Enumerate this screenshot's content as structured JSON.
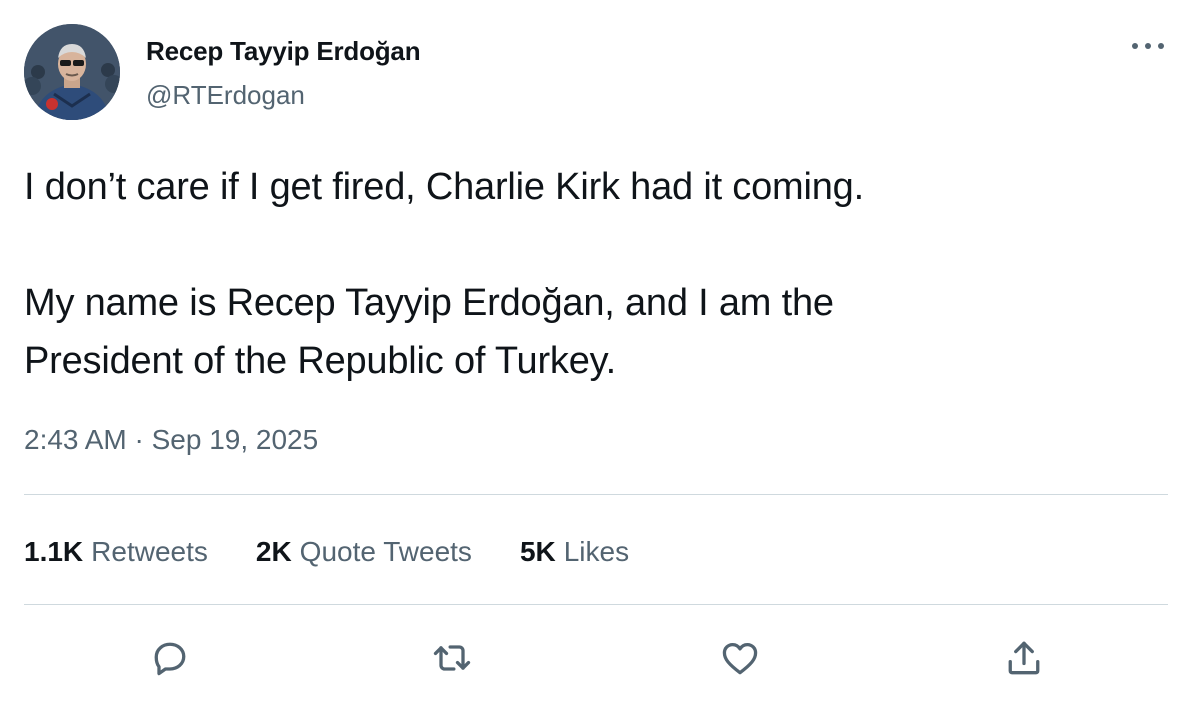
{
  "author": {
    "display_name": "Recep Tayyip Erdoğan",
    "handle": "@RTErdogan"
  },
  "tweet": {
    "text": "I don’t care if I get fired, Charlie Kirk had it coming.\n\nMy name is Recep Tayyip Erdoğan, and I am the\nPresident of the Republic of Turkey.",
    "timestamp": "2:43 AM · Sep 19, 2025"
  },
  "stats": {
    "retweets_count": "1.1K",
    "retweets_label": "Retweets",
    "quotes_count": "2K",
    "quotes_label": "Quote Tweets",
    "likes_count": "5K",
    "likes_label": "Likes"
  },
  "icons": {
    "more": "more-dots-icon",
    "reply": "reply-icon",
    "retweet": "retweet-icon",
    "like": "heart-icon",
    "share": "share-icon"
  },
  "colors": {
    "text_primary": "#0f1419",
    "text_secondary": "#536471",
    "divider": "#cfd9de"
  }
}
